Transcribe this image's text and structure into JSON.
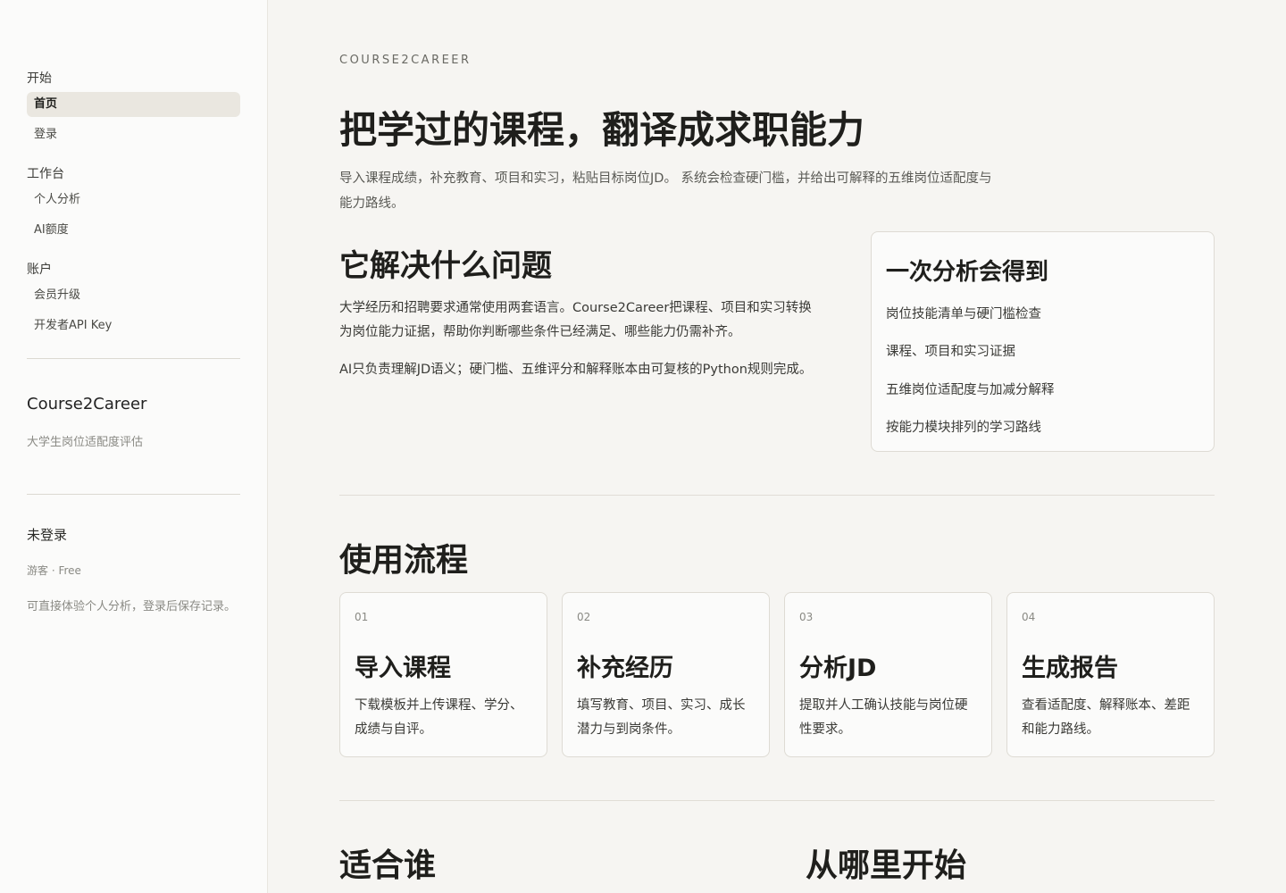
{
  "sidebar": {
    "sections": [
      {
        "title": "开始",
        "items": [
          {
            "label": "首页",
            "active": true
          },
          {
            "label": "登录",
            "active": false
          }
        ]
      },
      {
        "title": "工作台",
        "items": [
          {
            "label": "个人分析",
            "active": false
          },
          {
            "label": "AI额度",
            "active": false
          }
        ]
      },
      {
        "title": "账户",
        "items": [
          {
            "label": "会员升级",
            "active": false
          },
          {
            "label": "开发者API Key",
            "active": false
          }
        ]
      }
    ],
    "brand": {
      "name": "Course2Career",
      "subtitle": "大学生岗位适配度评估"
    },
    "user": {
      "status": "未登录",
      "tier": "游客 · Free",
      "note": "可直接体验个人分析，登录后保存记录。"
    }
  },
  "hero": {
    "eyebrow": "COURSE2CAREER",
    "title": "把学过的课程，翻译成求职能力",
    "description": "导入课程成绩，补充教育、项目和实习，粘贴目标岗位JD。 系统会检查硬门槛，并给出可解释的五维岗位适配度与能力路线。"
  },
  "problem": {
    "title": "它解决什么问题",
    "paragraphs": [
      "大学经历和招聘要求通常使用两套语言。Course2Career把课程、项目和实习转换为岗位能力证据，帮助你判断哪些条件已经满足、哪些能力仍需补齐。",
      "AI只负责理解JD语义；硬门槛、五维评分和解释账本由可复核的Python规则完成。"
    ]
  },
  "outcome": {
    "title": "一次分析会得到",
    "items": [
      "岗位技能清单与硬门槛检查",
      "课程、项目和实习证据",
      "五维岗位适配度与加减分解释",
      "按能力模块排列的学习路线"
    ]
  },
  "flow": {
    "title": "使用流程",
    "steps": [
      {
        "num": "01",
        "title": "导入课程",
        "desc": "下载模板并上传课程、学分、成绩与自评。"
      },
      {
        "num": "02",
        "title": "补充经历",
        "desc": "填写教育、项目、实习、成长潜力与到岗条件。"
      },
      {
        "num": "03",
        "title": "分析JD",
        "desc": "提取并人工确认技能与岗位硬性要求。"
      },
      {
        "num": "04",
        "title": "生成报告",
        "desc": "查看适配度、解释账本、差距和能力路线。"
      }
    ]
  },
  "bottom": {
    "left_title": "适合谁",
    "right_title": "从哪里开始"
  }
}
